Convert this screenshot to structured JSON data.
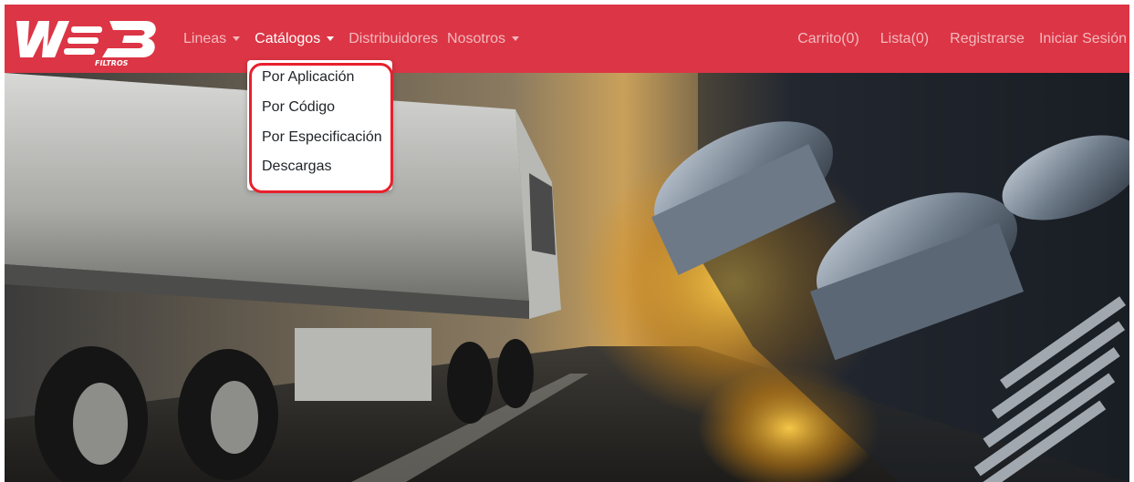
{
  "navbar": {
    "brand_name": "FILTROS",
    "brand_color": "#dc3545",
    "left_items": [
      {
        "label": "Lineas",
        "has_caret": true,
        "active": false
      },
      {
        "label": "Catálogos",
        "has_caret": true,
        "active": true
      },
      {
        "label": "Distribuidores",
        "has_caret": false,
        "active": false
      },
      {
        "label": "Nosotros",
        "has_caret": true,
        "active": false
      }
    ],
    "right_items": [
      {
        "label": "Carrito(0)"
      },
      {
        "label": "Lista(0)"
      },
      {
        "label": "Registrarse"
      },
      {
        "label": "Iniciar Sesión"
      }
    ]
  },
  "catalog_dropdown": {
    "items": [
      {
        "label": "Por Aplicación"
      },
      {
        "label": "Por Código"
      },
      {
        "label": "Por Especificación"
      },
      {
        "label": "Descargas"
      }
    ],
    "highlight_color": "#e8202c"
  },
  "icons": {
    "caret": "caret-down-icon",
    "logo": "web-filtros-logo"
  }
}
